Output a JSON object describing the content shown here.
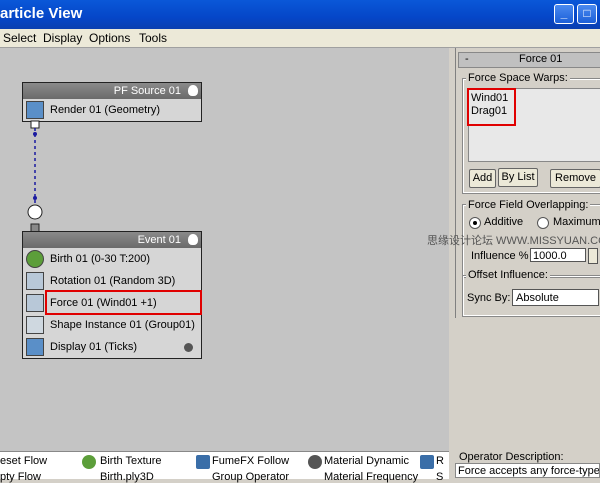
{
  "window": {
    "title": "article View"
  },
  "menu": [
    "Select",
    "Display",
    "Options",
    "Tools"
  ],
  "nodes": {
    "source": {
      "title": "PF Source 01",
      "rows": [
        "Render 01 (Geometry)"
      ]
    },
    "event": {
      "title": "Event 01",
      "rows": [
        "Birth 01 (0-30 T:200)",
        "Rotation 01 (Random 3D)",
        "Force 01 (Wind01 +1)",
        "Shape Instance 01 (Group01)",
        "Display 01 (Ticks)"
      ]
    }
  },
  "panel": {
    "rollout_title": "Force 01",
    "collapse_symbol": "-",
    "force_space_warps_label": "Force Space Warps:",
    "warps": [
      "Wind01",
      "Drag01"
    ],
    "add_label": "Add",
    "by_list_label": "By List",
    "remove_label": "Remove",
    "overlap_label": "Force Field Overlapping:",
    "additive_label": "Additive",
    "maximum_label": "Maximum",
    "influence_label": "Influence %",
    "influence_value": "1000.0",
    "offset_label": "Offset Influence:",
    "sync_label": "Sync By:",
    "sync_value": "Absolute"
  },
  "watermark": "思缘设计论坛 WWW.MISSYUAN.COM",
  "bottom": {
    "items_row1": [
      "eset Flow",
      "Birth Texture",
      "FumeFX Follow",
      "Material Dynamic",
      "R"
    ],
    "items_row2": [
      "pty Flow",
      "Birth.ply3D",
      "Group Operator",
      "Material Frequency",
      "S"
    ]
  },
  "operator_description": {
    "label": "Operator Description:",
    "text": "Force accepts any force-type"
  },
  "colors": {
    "highlight": "#e00000",
    "wire": "#1a1aa0"
  }
}
